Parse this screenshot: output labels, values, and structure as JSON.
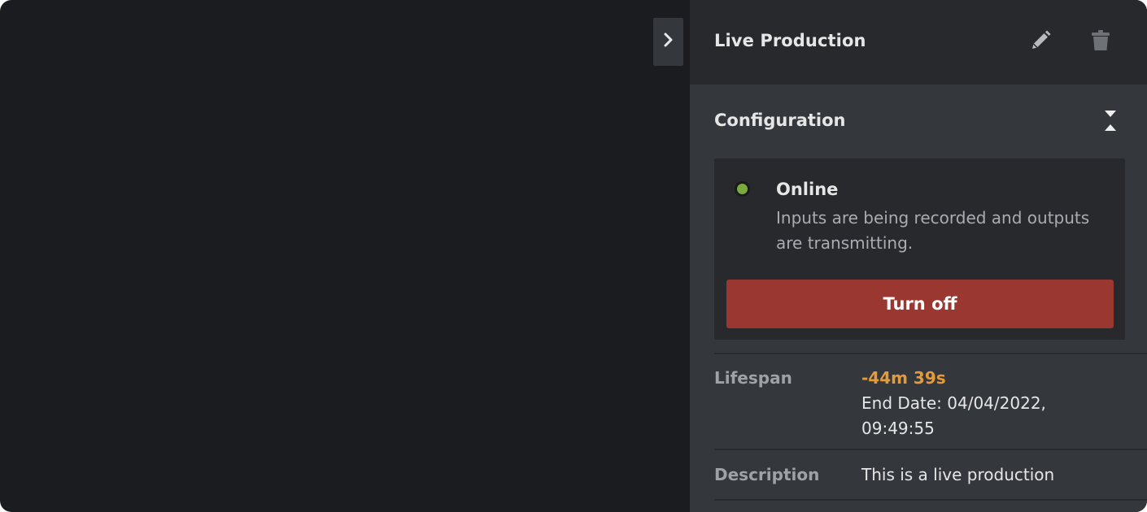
{
  "panel": {
    "toggle_icon": "chevron-right-icon",
    "title": "Live Production",
    "edit_icon": "pencil-icon",
    "delete_icon": "trash-icon"
  },
  "configuration": {
    "title": "Configuration",
    "collapse_icon": "collapse-icon",
    "status": {
      "color": "#7bab3e",
      "title": "Online",
      "description": "Inputs are being recorded and outputs are transmitting.",
      "button_label": "Turn off",
      "button_color": "#9b3731"
    }
  },
  "details": {
    "lifespan_label": "Lifespan",
    "lifespan_remaining": "-44m 39s",
    "lifespan_remaining_color": "#e39b3b",
    "lifespan_end": "End Date: 04/04/2022, 09:49:55",
    "description_label": "Description",
    "description_value": "This is a live production"
  }
}
